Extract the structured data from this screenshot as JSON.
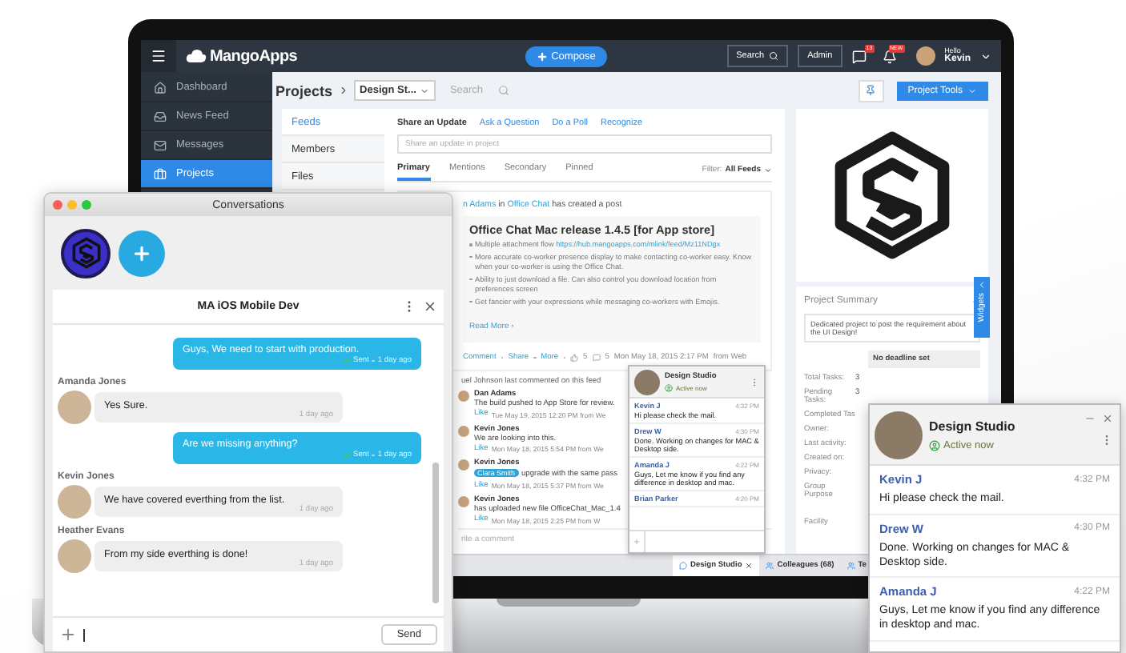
{
  "app": {
    "header": {
      "logo": "MangoApps",
      "compose": "Compose",
      "search": "Search",
      "admin": "Admin",
      "chat_badge": "13",
      "alert_badge": "NEW",
      "greeting": "Hello",
      "user": "Kevin"
    },
    "nav": [
      {
        "label": "Dashboard",
        "selected": false
      },
      {
        "label": "News Feed",
        "selected": false
      },
      {
        "label": "Messages",
        "selected": false
      },
      {
        "label": "Projects",
        "selected": true
      }
    ],
    "project_bar": {
      "title": "Projects",
      "project": "Design St...",
      "search_placeholder": "Search",
      "tools": "Project Tools"
    },
    "subnav": [
      {
        "label": "Feeds",
        "selected": true
      },
      {
        "label": "Members",
        "selected": false
      },
      {
        "label": "Files",
        "selected": false
      }
    ],
    "share_tabs": [
      {
        "label": "Share an Update",
        "selected": true
      },
      {
        "label": "Ask a Question",
        "selected": false
      },
      {
        "label": "Do a Poll",
        "selected": false
      },
      {
        "label": "Recognize",
        "selected": false
      }
    ],
    "share_placeholder": "Share an update in project",
    "feed_tabs": [
      {
        "label": "Primary",
        "selected": true
      },
      {
        "label": "Mentions",
        "selected": false
      },
      {
        "label": "Secondary",
        "selected": false
      },
      {
        "label": "Pinned",
        "selected": false
      }
    ],
    "filter": {
      "label": "Filter:",
      "value": "All Feeds"
    },
    "post": {
      "author": "n Adams",
      "connector": "in",
      "channel": "Office Chat",
      "action": "has created a post",
      "title": "Office Chat Mac release 1.4.5 [for App store]",
      "bullets": [
        {
          "text": "Multiple attachment flow",
          "link": "https://hub.mangoapps.com/mlink/feed/Mz11NDgx"
        },
        {
          "text": "More accurate co-worker presence display to make contacting co-worker easy. Know when your co-worker is using the Office Chat."
        },
        {
          "text": "Ability to just download a file. Can also control you download location from preferences screen"
        },
        {
          "text": "Get fancier with your expressions while messaging co-workers with Emojis."
        }
      ],
      "read_more": "Read More ›",
      "actions": [
        "Comment",
        "Share",
        "More"
      ],
      "likes": "5",
      "comments": "5",
      "time": "Mon May 18, 2015 2:17 PM",
      "source": "from Web"
    },
    "last_comment": "uel Johnson last commented on this feed",
    "comments": [
      {
        "author": "Dan Adams",
        "text": "The build pushed to App Store for review.",
        "like": "Like",
        "time": "Tue May 19, 2015 12:20 PM from We"
      },
      {
        "author": "Kevin Jones",
        "text": "We are looking into this.",
        "like": "Like",
        "time": "Mon May 18, 2015 5:54 PM from We"
      },
      {
        "author": "Kevin Jones",
        "mention": "Clara Smith",
        "text": "upgrade with the same pass",
        "like": "Like",
        "time": "Mon May 18, 2015 5:37 PM from We"
      },
      {
        "author": "Kevin Jones",
        "text": "has uploaded new file OfficeChat_Mac_1.4",
        "like": "Like",
        "time": "Mon May 18, 2015 2:25 PM from W"
      }
    ],
    "comment_placeholder": "rite a comment",
    "summary": {
      "title": "Project Summary",
      "description": "Dedicated project to post the requirement about the UI Design!",
      "deadline": "No deadline set",
      "rows": [
        {
          "label": "Total Tasks:",
          "value": "3"
        },
        {
          "label": "Pending Tasks:",
          "value": "3"
        },
        {
          "label": "Completed Tas"
        },
        {
          "label": "Owner:"
        },
        {
          "label": "Last activity:"
        },
        {
          "label": "Created on:"
        },
        {
          "label": "Privacy:"
        },
        {
          "label": "Group Purpose"
        },
        {
          "label": "Facility"
        }
      ]
    },
    "widgets": "Widgets",
    "dock": [
      {
        "label": "Design Studio",
        "selected": true
      },
      {
        "label": "Colleagues (68)",
        "selected": false
      },
      {
        "label": "Te",
        "selected": false
      }
    ],
    "mini_chat": {
      "title": "Design Studio",
      "status": "Active now",
      "messages": [
        {
          "sender": "Kevin J",
          "time": "4:32 PM",
          "text": "Hi please check the mail."
        },
        {
          "sender": "Drew W",
          "time": "4:30 PM",
          "text": "Done. Working on changes for MAC & Desktop side."
        },
        {
          "sender": "Amanda J",
          "time": "4:22 PM",
          "text": "Guys, Let me know if you find any difference in desktop and mac."
        },
        {
          "sender": "Brian Parker",
          "time": "4:20 PM"
        }
      ]
    }
  },
  "conversations": {
    "title": "Conversations",
    "chat_title": "MA iOS Mobile Dev",
    "messages": [
      {
        "kind": "outgoing",
        "text": "Guys, We need to start with production.",
        "status": "Sent",
        "time": "1 day ago"
      },
      {
        "kind": "incoming",
        "sender": "Amanda Jones",
        "text": "Yes Sure.",
        "time": "1 day ago"
      },
      {
        "kind": "outgoing",
        "text": "Are we missing anything?",
        "status": "Sent",
        "time": "1 day ago"
      },
      {
        "kind": "incoming",
        "sender": "Kevin Jones",
        "text": "We have covered everthing from the list.",
        "time": "1 day ago"
      },
      {
        "kind": "incoming",
        "sender": "Heather Evans",
        "text": "From my side everthing is done!",
        "time": "1 day ago"
      }
    ],
    "send": "Send"
  },
  "chat_popup": {
    "title": "Design Studio",
    "status": "Active now",
    "messages": [
      {
        "sender": "Kevin J",
        "time": "4:32 PM",
        "text": "Hi please check the mail."
      },
      {
        "sender": "Drew W",
        "time": "4:30 PM",
        "text": "Done. Working on changes for MAC & Desktop side."
      },
      {
        "sender": "Amanda J",
        "time": "4:22 PM",
        "text": "Guys, Let me know if you find any difference in desktop and mac."
      }
    ]
  }
}
